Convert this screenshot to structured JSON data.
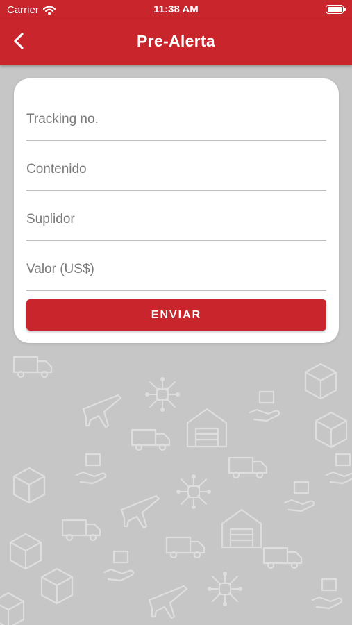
{
  "status_bar": {
    "carrier": "Carrier",
    "time": "11:38 AM",
    "icons": [
      "wifi-icon",
      "battery-icon"
    ]
  },
  "nav": {
    "title": "Pre-Alerta",
    "back_icon": "chevron-left-icon"
  },
  "form": {
    "fields": [
      {
        "placeholder": "Tracking no.",
        "value": ""
      },
      {
        "placeholder": "Contenido",
        "value": ""
      },
      {
        "placeholder": "Suplidor",
        "value": ""
      },
      {
        "placeholder": "Valor (US$)",
        "value": ""
      }
    ],
    "submit_label": "ENVIAR"
  },
  "colors": {
    "brand_red": "#c8252c",
    "background_gray": "#c6c6c6",
    "pattern_stroke": "#dcdcdc"
  }
}
